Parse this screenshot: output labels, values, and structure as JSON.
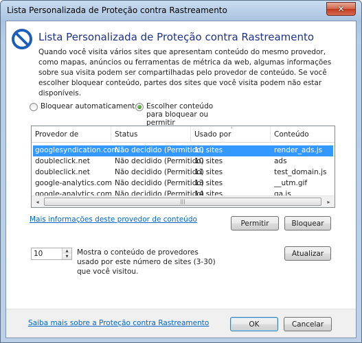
{
  "window": {
    "title": "Lista Personalizada de Proteção contra Rastreamento",
    "close_glyph": "✕"
  },
  "header": {
    "icon": "block-icon",
    "title": "Lista Personalizada de Proteção contra Rastreamento",
    "description": "Quando você visita vários sites que apresentam conteúdo do mesmo provedor, como mapas, anúncios ou ferramentas de métrica da web, algumas informações sobre sua visita podem ser compartilhadas pelo provedor de conteúdo. Se você escolher bloquear conteúdo, partes dos sites que você visita podem não estar disponíveis."
  },
  "options": {
    "auto_block_label": "Bloquear automaticamente",
    "choose_label": "Escolher conteúdo para bloquear ou permitir",
    "selected": "choose"
  },
  "list": {
    "columns": [
      "Provedor de conteúdo",
      "Status",
      "Usado por",
      "Conteúdo"
    ],
    "sort_indicator": "˄",
    "rows": [
      {
        "provider": "googlesyndication.com",
        "status": "Não decidido (Permitido)",
        "used_by": "10 sites",
        "content": "render_ads.js",
        "selected": true
      },
      {
        "provider": "doubleclick.net",
        "status": "Não decidido (Permitido)",
        "used_by": "10 sites",
        "content": "ads",
        "selected": false
      },
      {
        "provider": "doubleclick.net",
        "status": "Não decidido (Permitido)",
        "used_by": "11 sites",
        "content": "test_domain.js",
        "selected": false
      },
      {
        "provider": "google-analytics.com",
        "status": "Não decidido (Permitido)",
        "used_by": "13 sites",
        "content": "__utm.gif",
        "selected": false
      },
      {
        "provider": "google-analytics.com",
        "status": "Não decidido (Permitido)",
        "used_by": "14 sites",
        "content": "ga.js",
        "selected": false
      }
    ],
    "scroll_left": "◂",
    "scroll_right": "▸",
    "scroll_grip": "|||"
  },
  "provider_link": "Mais informações deste provedor de conteúdo",
  "allow_button": "Permitir",
  "block_button": "Bloquear",
  "threshold": {
    "value": "10",
    "up": "▲",
    "down": "▼",
    "label": "Mostra o conteúdo de provedores usado por este número de sites (3-30) que você visitou."
  },
  "refresh_button": "Atualizar",
  "footer": {
    "learn_more_link": "Saiba mais sobre a Proteção contra Rastreamento",
    "ok_button": "OK",
    "cancel_button": "Cancelar"
  }
}
